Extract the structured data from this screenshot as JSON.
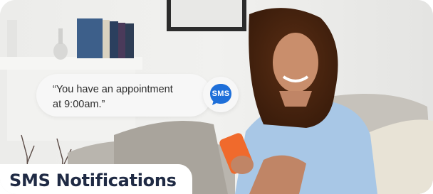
{
  "bubble": {
    "message": "“You have an appointment\nat 9:00am.”"
  },
  "badge": {
    "label": "SMS",
    "icon": "chat-bubble-icon",
    "color": "#1e6fd9"
  },
  "title": {
    "text": "SMS Notifications",
    "color": "#1f2a44"
  }
}
